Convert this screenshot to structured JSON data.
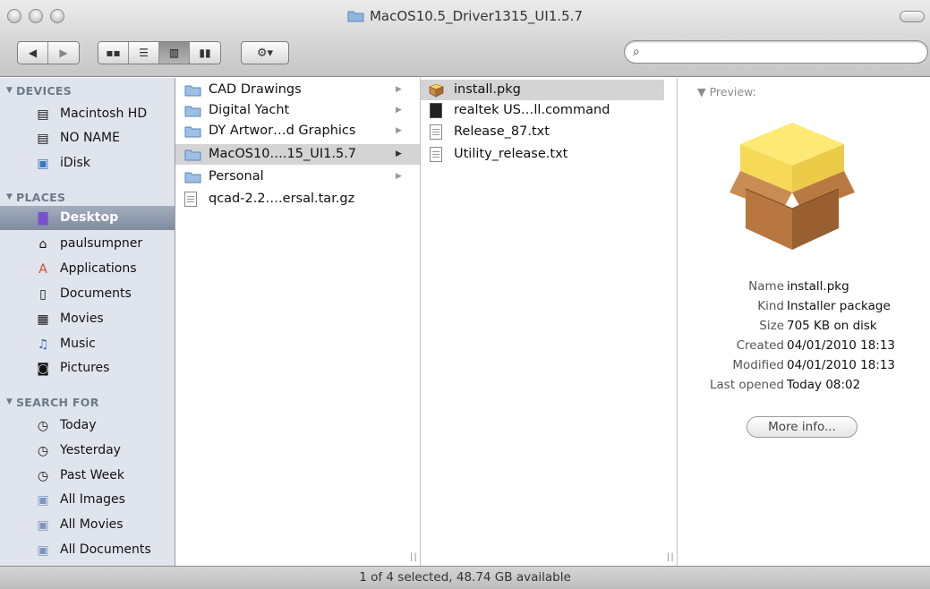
{
  "window": {
    "title": "MacOS10.5_Driver1315_UI1.5.7"
  },
  "toolbar": {
    "back_icon": "back-arrow-icon",
    "forward_icon": "forward-arrow-icon",
    "view_modes": [
      "icon-view",
      "list-view",
      "column-view",
      "coverflow-view"
    ],
    "active_view": "column-view",
    "action_label": "⚙▾",
    "search_placeholder": ""
  },
  "sidebar": {
    "devices_header": "DEVICES",
    "devices": [
      {
        "label": "Macintosh HD",
        "icon": "harddisk-icon"
      },
      {
        "label": "NO NAME",
        "icon": "harddisk-icon"
      },
      {
        "label": "iDisk",
        "icon": "idisk-icon"
      }
    ],
    "places_header": "PLACES",
    "places": [
      {
        "label": "Desktop",
        "icon": "desktop-icon",
        "selected": true
      },
      {
        "label": "paulsumpner",
        "icon": "home-icon"
      },
      {
        "label": "Applications",
        "icon": "applications-icon"
      },
      {
        "label": "Documents",
        "icon": "documents-icon"
      },
      {
        "label": "Movies",
        "icon": "movies-icon"
      },
      {
        "label": "Music",
        "icon": "music-icon"
      },
      {
        "label": "Pictures",
        "icon": "pictures-icon"
      }
    ],
    "search_header": "SEARCH FOR",
    "searches": [
      {
        "label": "Today",
        "icon": "clock-icon"
      },
      {
        "label": "Yesterday",
        "icon": "clock-icon"
      },
      {
        "label": "Past Week",
        "icon": "clock-icon"
      },
      {
        "label": "All Images",
        "icon": "smart-folder-icon"
      },
      {
        "label": "All Movies",
        "icon": "smart-folder-icon"
      },
      {
        "label": "All Documents",
        "icon": "smart-folder-icon"
      }
    ]
  },
  "column1": {
    "items": [
      {
        "label": "CAD Drawings",
        "type": "folder"
      },
      {
        "label": "Digital Yacht",
        "type": "folder"
      },
      {
        "label": "DY Artwor…d Graphics",
        "type": "folder"
      },
      {
        "label": "MacOS10….15_UI1.5.7",
        "type": "folder",
        "selected": true
      },
      {
        "label": "Personal",
        "type": "folder"
      },
      {
        "label": "qcad-2.2….ersal.tar.gz",
        "type": "file"
      }
    ]
  },
  "column2": {
    "items": [
      {
        "label": "install.pkg",
        "type": "pkg",
        "selected": true
      },
      {
        "label": "realtek US…ll.command",
        "type": "command"
      },
      {
        "label": "Release_87.txt",
        "type": "text"
      },
      {
        "label": "Utility_release.txt",
        "type": "text"
      }
    ]
  },
  "preview": {
    "header": "▼ Preview:",
    "info": [
      {
        "key": "Name",
        "value": "install.pkg"
      },
      {
        "key": "Kind",
        "value": "Installer package"
      },
      {
        "key": "Size",
        "value": "705 KB on disk"
      },
      {
        "key": "Created",
        "value": "04/01/2010 18:13"
      },
      {
        "key": "Modified",
        "value": "04/01/2010 18:13"
      },
      {
        "key": "Last opened",
        "value": "Today 08:02"
      }
    ],
    "more_info_label": "More info..."
  },
  "status": {
    "text": "1 of 4 selected, 48.74 GB available"
  },
  "colors": {
    "sidebar_bg": "#e0e5ed",
    "selection": "#d4d4d4",
    "sidebar_selection": "#8c97aa"
  }
}
